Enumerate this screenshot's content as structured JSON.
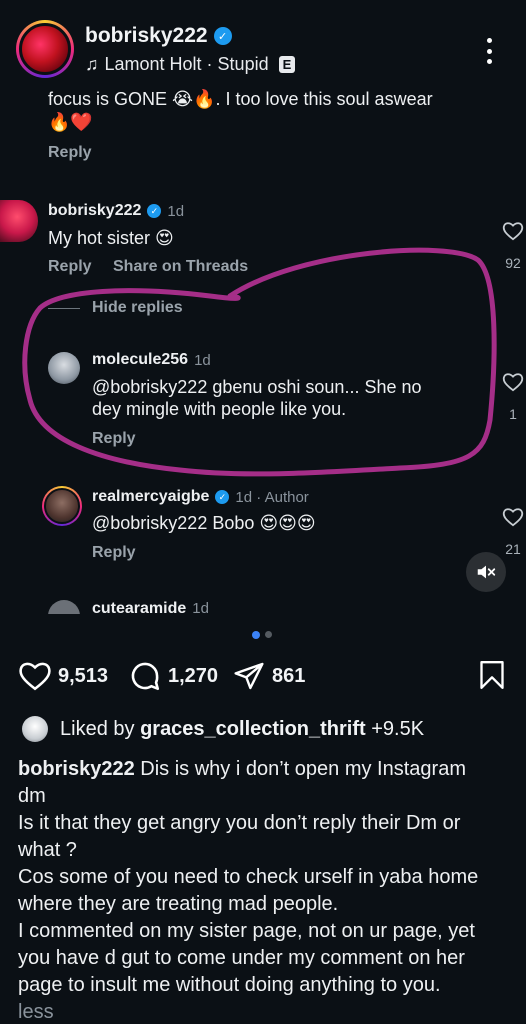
{
  "header": {
    "username": "bobrisky222",
    "music": "Lamont Holt · Stupid",
    "explicit_badge": "E"
  },
  "comments": {
    "partial": {
      "text": "focus is GONE 😭🔥. I too love this soul aswear",
      "text2": "🔥❤️",
      "reply": "Reply"
    },
    "bob": {
      "user": "bobrisky222",
      "time": "1d",
      "text": "My hot sister 😍",
      "reply": "Reply",
      "share": "Share on Threads",
      "likes": "92"
    },
    "hide_replies": "Hide replies",
    "molecule": {
      "user": "molecule256",
      "time": "1d",
      "text1": "@bobrisky222 gbenu oshi soun... She no",
      "text2": "dey mingle with people like you.",
      "reply": "Reply",
      "likes": "1"
    },
    "mercy": {
      "user": "realmercyaigbe",
      "time": "1d · Author",
      "text": "@bobrisky222 Bobo 😍😍😍",
      "reply": "Reply",
      "likes": "21"
    },
    "cute": {
      "user": "cutearamide",
      "time": "1d"
    }
  },
  "actions": {
    "likes": "9,513",
    "comments": "1,270",
    "shares": "861"
  },
  "liked_by": {
    "prefix": "Liked by",
    "user": "graces_collection_thrift",
    "suffix": "+9.5K"
  },
  "caption": {
    "user": "bobrisky222",
    "lines": [
      "Dis is why i don’t open my Instagram",
      "dm",
      "Is it that they get angry you don’t reply their Dm or",
      "what ?",
      "Cos some of you need to check urself in yaba home",
      "where they are treating mad people.",
      "I commented on my sister page, not on ur page, yet",
      "you have d gut to come under my comment on her",
      "page to insult me without doing anything to you."
    ],
    "less": "less"
  },
  "colors": {
    "background": "#0b1015",
    "annotation": "#a52e88",
    "verified": "#1d9bf0",
    "carousel_active": "#3b82f6"
  }
}
